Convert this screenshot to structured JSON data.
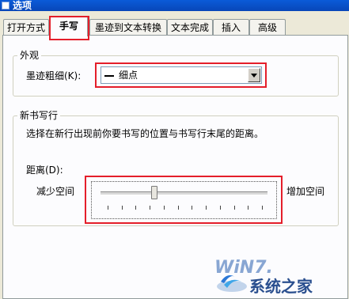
{
  "window": {
    "title": "选项"
  },
  "tabs": [
    {
      "label": "打开方式",
      "active": false
    },
    {
      "label": "手写",
      "active": true
    },
    {
      "label": "墨迹到文本转换",
      "active": false
    },
    {
      "label": "文本完成",
      "active": false
    },
    {
      "label": "插入",
      "active": false
    },
    {
      "label": "高级",
      "active": false
    }
  ],
  "appearance": {
    "group_label": "外观",
    "ink_thickness_label": "墨迹粗细(K):",
    "ink_thickness_value": "细点"
  },
  "new_line": {
    "group_label": "新书写行",
    "description": "选择在新行出现前你要书写的位置与书写行末尾的距离。",
    "distance_label": "距离(D):",
    "less_space": "减少空间",
    "more_space": "增加空间",
    "distance_level": 0.3,
    "tick_count": 12
  },
  "watermark": {
    "brand": "WiN7.",
    "site_name": "系统之家"
  },
  "colors": {
    "highlight": "#e41e2a",
    "titlebar": "#0a5bd8"
  }
}
